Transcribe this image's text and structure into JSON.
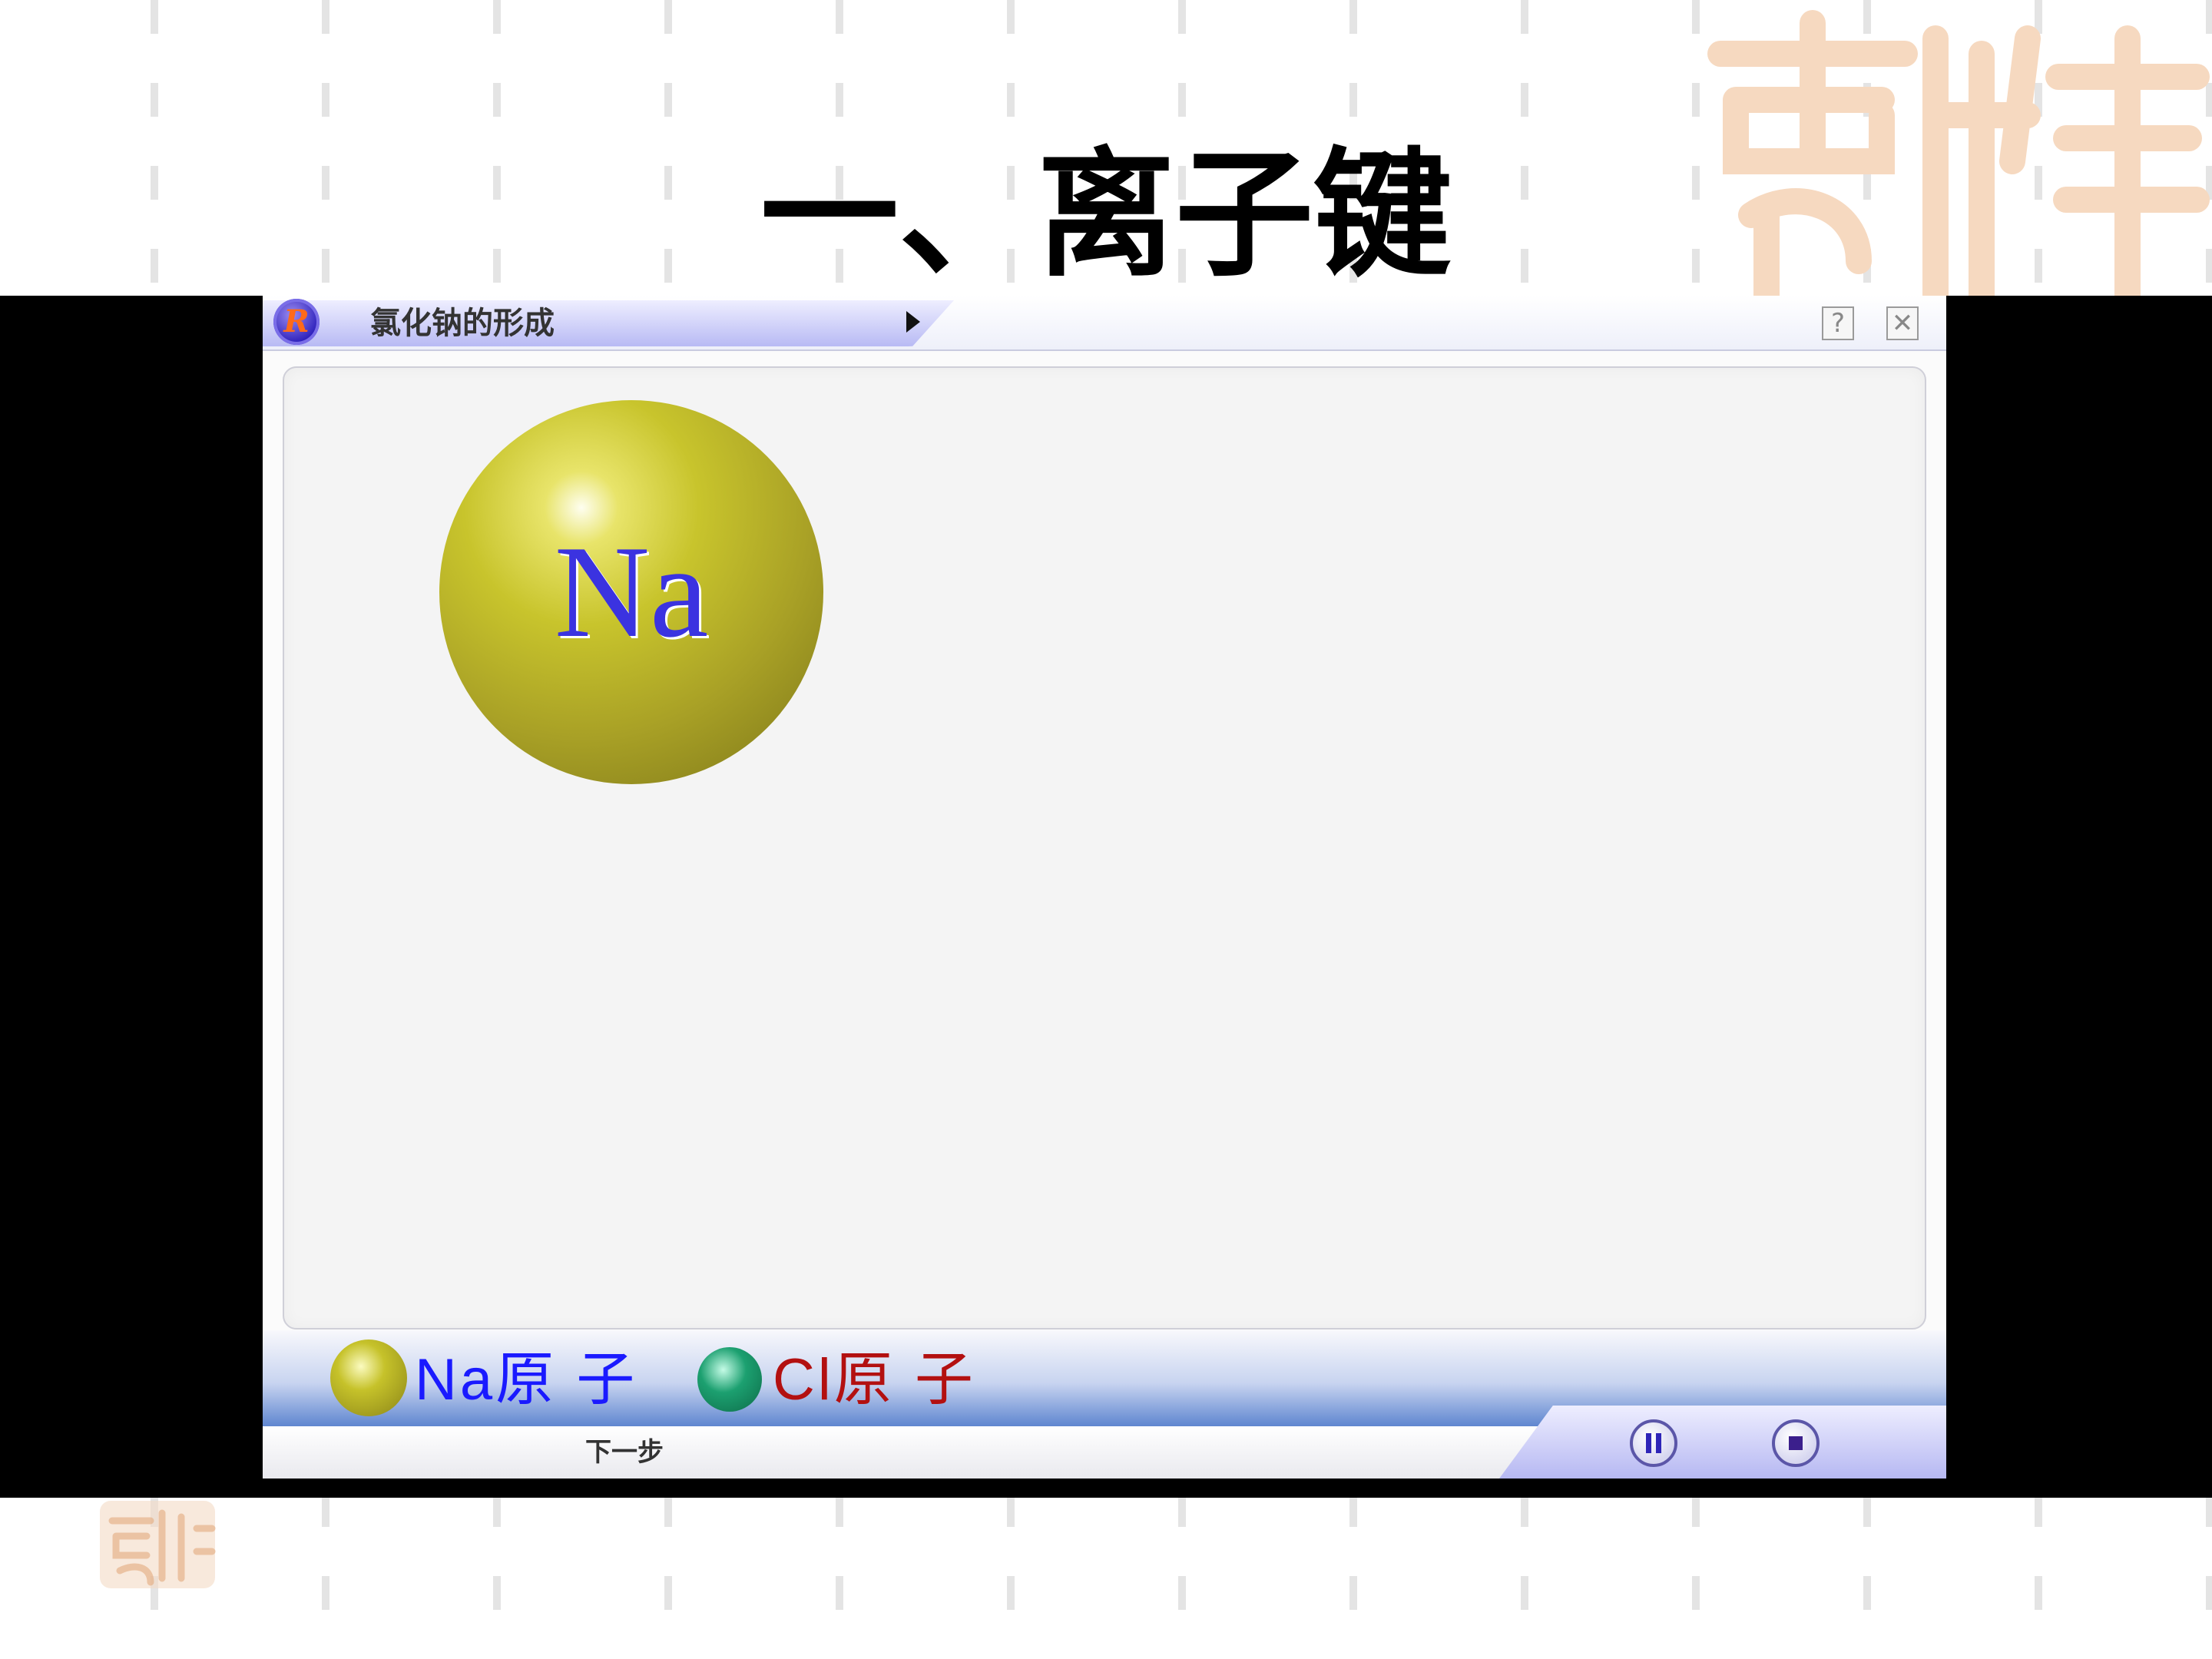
{
  "slide": {
    "title": "一、离子键"
  },
  "window": {
    "title": "氯化钠的形成",
    "help_label": "?",
    "close_label": "✕"
  },
  "stage": {
    "atom_label": "Na"
  },
  "legend": {
    "items": [
      {
        "label": "Na原 子",
        "color": "#1a1aff",
        "ball_color": "#c6c22a"
      },
      {
        "label": "Cl原 子",
        "color": "#b31010",
        "ball_color": "#1ca070"
      }
    ]
  },
  "controls": {
    "next_step_label": "下一步",
    "pause_icon": "pause-icon",
    "stop_icon": "stop-icon"
  },
  "colors": {
    "accent": "#b8baf4",
    "title_text": "#000000",
    "na_label": "#3b33e0"
  }
}
